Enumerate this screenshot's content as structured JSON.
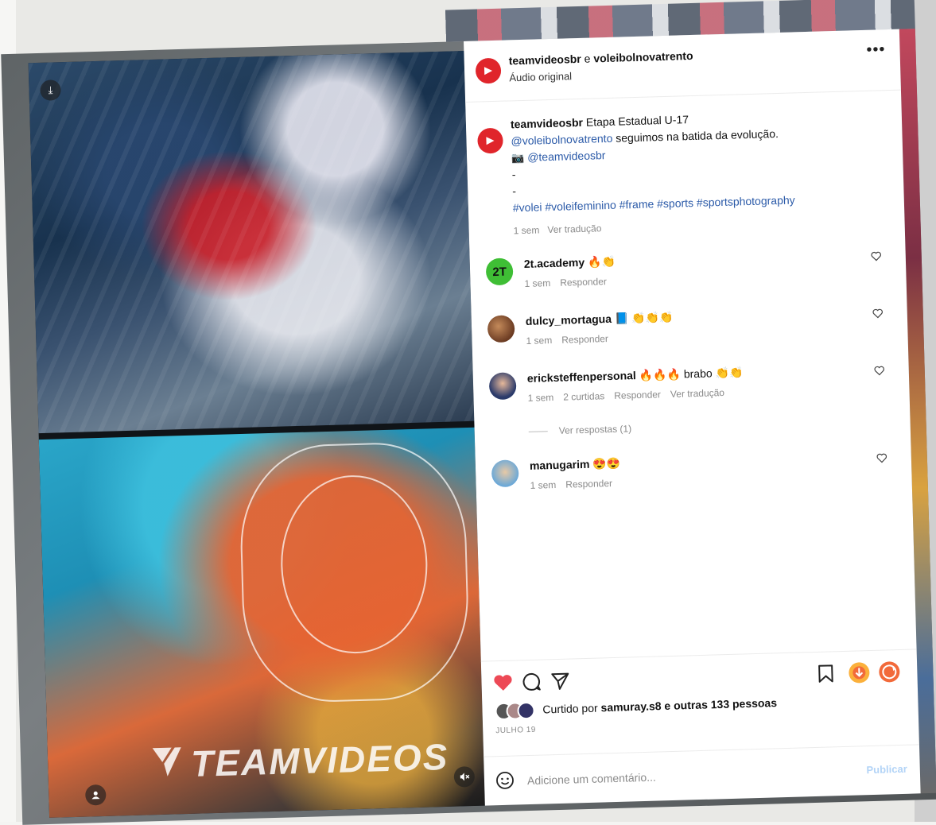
{
  "post": {
    "header_title_user1": "teamvideosbr",
    "header_title_connector": " e ",
    "header_title_user2": "voleibolnovatrento",
    "header_subtitle": "Áudio original",
    "more_label": "•••"
  },
  "caption": {
    "author": "teamvideosbr",
    "title": "Etapa Estadual U-17",
    "mention": "@voleibolnovatrento",
    "line1_rest": " seguimos na batida da evolução.",
    "camera_emoji": "📷",
    "credit": "@teamvideosbr",
    "sep1": "-",
    "sep2": "-",
    "hashtags": "#volei #voleifeminino #frame #sports #sportsphotography",
    "time": "1 sem",
    "translate": "Ver tradução"
  },
  "comments": [
    {
      "user": "2t.academy",
      "text": "🔥👏",
      "time": "1 sem",
      "reply": "Responder"
    },
    {
      "user": "dulcy_mortagua",
      "text": "📘 👏👏👏",
      "time": "1 sem",
      "reply": "Responder"
    },
    {
      "user": "ericksteffenpersonal",
      "text": "🔥🔥🔥 brabo 👏👏",
      "time": "1 sem",
      "likes": "2 curtidas",
      "reply": "Responder",
      "translate": "Ver tradução",
      "view_replies": "Ver respostas (1)"
    },
    {
      "user": "manugarim",
      "text": "😍😍",
      "time": "1 sem",
      "reply": "Responder"
    }
  ],
  "footer": {
    "liked_prefix": "Curtido por ",
    "liked_user": "samuray.s8",
    "liked_suffix": " e outras 133 pessoas",
    "date": "JULHO 19",
    "comment_placeholder": "Adicione um comentário...",
    "publish": "Publicar"
  },
  "media": {
    "watermark": "TEAMVIDEOS"
  },
  "colors": {
    "accent": "#e0252b",
    "heart": "#ed4956",
    "link": "#2b5aa8"
  }
}
